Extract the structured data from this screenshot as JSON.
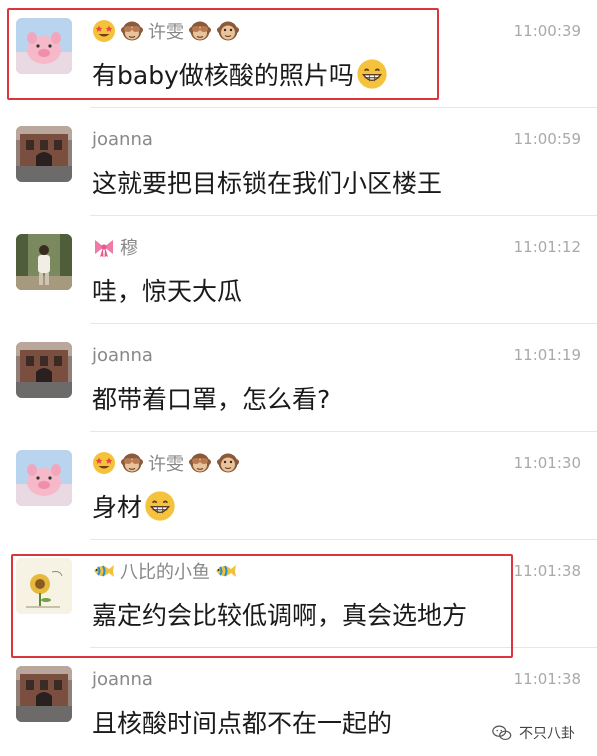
{
  "messages": [
    {
      "sender": "许雯",
      "name_emojis_before": [
        "star-struck-emoji",
        "see-no-evil-monkey-emoji"
      ],
      "name_emojis_after": [
        "see-no-evil-monkey-emoji",
        "monkey-face-emoji"
      ],
      "time": "11:00:39",
      "text": "有baby做核酸的照片吗",
      "text_emoji": "grinning-emoji",
      "avatar": "pink-pig-avatar",
      "highlighted": true
    },
    {
      "sender": "joanna",
      "time": "11:00:59",
      "text": "这就要把目标锁在我们小区楼王",
      "avatar": "building-street-avatar"
    },
    {
      "sender": "穆",
      "name_emojis_before": [
        "ribbon-emoji"
      ],
      "time": "11:01:12",
      "text": "哇，惊天大瓜",
      "avatar": "person-forest-avatar"
    },
    {
      "sender": "joanna",
      "time": "11:01:19",
      "text": "都带着口罩，怎么看?",
      "avatar": "building-street-avatar"
    },
    {
      "sender": "许雯",
      "name_emojis_before": [
        "star-struck-emoji",
        "see-no-evil-monkey-emoji"
      ],
      "name_emojis_after": [
        "see-no-evil-monkey-emoji",
        "monkey-face-emoji"
      ],
      "time": "11:01:30",
      "text": "身材",
      "text_emoji": "grinning-emoji",
      "avatar": "pink-pig-avatar"
    },
    {
      "sender": "八比的小鱼",
      "name_emojis_before": [
        "tropical-fish-emoji"
      ],
      "name_emojis_after": [
        "tropical-fish-emoji"
      ],
      "time": "11:01:38",
      "text": "嘉定约会比较低调啊，真会选地方",
      "avatar": "sunflower-drawing-avatar",
      "highlighted": true
    },
    {
      "sender": "joanna",
      "time": "11:01:38",
      "text": "且核酸时间点都不在一起的",
      "avatar": "building-street-avatar"
    }
  ],
  "watermark": {
    "text": "不只八卦",
    "icon": "wechat-icon"
  }
}
